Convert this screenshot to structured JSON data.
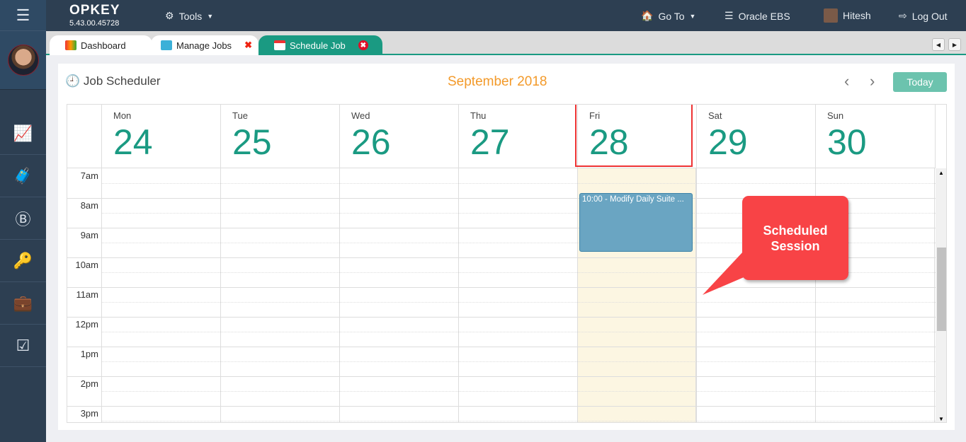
{
  "app": {
    "logo": "OPKEY",
    "version": "5.43.00.45728"
  },
  "topbar": {
    "tools": "Tools",
    "goto": "Go To",
    "project": "Oracle EBS",
    "user": "Hitesh",
    "logout": "Log Out"
  },
  "tabs": [
    {
      "label": "Dashboard"
    },
    {
      "label": "Manage Jobs"
    },
    {
      "label": "Schedule Job"
    }
  ],
  "scheduler": {
    "title": "Job Scheduler",
    "month": "September 2018",
    "today": "Today",
    "days": [
      {
        "name": "Mon",
        "num": "24"
      },
      {
        "name": "Tue",
        "num": "25"
      },
      {
        "name": "Wed",
        "num": "26"
      },
      {
        "name": "Thu",
        "num": "27"
      },
      {
        "name": "Fri",
        "num": "28"
      },
      {
        "name": "Sat",
        "num": "29"
      },
      {
        "name": "Sun",
        "num": "30"
      }
    ],
    "hours": [
      "7am",
      "8am",
      "9am",
      "10am",
      "11am",
      "12pm",
      "1pm",
      "2pm",
      "3pm"
    ],
    "event": {
      "label": "10:00 - Modify Daily Suite ..."
    }
  },
  "annotation": {
    "line1": "Scheduled",
    "line2": "Session"
  },
  "colors": {
    "accent": "#1a9a82",
    "month": "#f39a2a",
    "event": "#6aa5c2",
    "today_highlight": "#fcf8e3",
    "callout": "#f84346"
  }
}
